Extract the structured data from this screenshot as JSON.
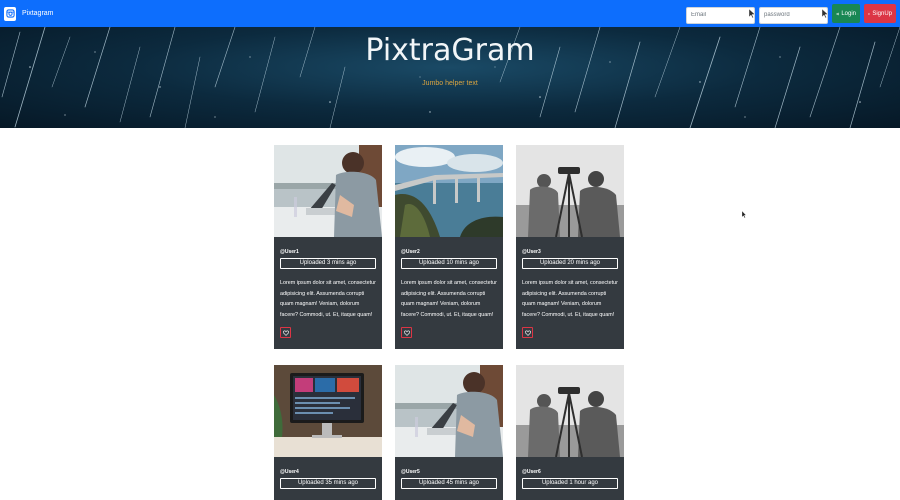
{
  "navbar": {
    "brand": "Pixtagram",
    "email_placeholder": "Email",
    "password_placeholder": "password",
    "login_label": "Login",
    "signup_label": "SignUp"
  },
  "jumbotron": {
    "title": "PixtraGram",
    "subtitle": "Jumbo helper text"
  },
  "posts": [
    {
      "user": "@User1",
      "uploaded": "Uploaded 3 mins ago",
      "text": "Lorem ipsum dolor sit amet, consectetur adipisicing elit. Assumenda corrupti quam magnam! Veniam, dolorum facere? Commodi, ut. Et, itaque quam!"
    },
    {
      "user": "@User2",
      "uploaded": "Uploaded 10 mins ago",
      "text": "Lorem ipsum dolor sit amet, consectetur adipisicing elit. Assumenda corrupti quam magnam! Veniam, dolorum facere? Commodi, ut. Et, itaque quam!"
    },
    {
      "user": "@User3",
      "uploaded": "Uploaded 20 mins ago",
      "text": "Lorem ipsum dolor sit amet, consectetur adipisicing elit. Assumenda corrupti quam magnam! Veniam, dolorum facere? Commodi, ut. Et, itaque quam!"
    },
    {
      "user": "@User4",
      "uploaded": "Uploaded 35 mins ago",
      "text": ""
    },
    {
      "user": "@User5",
      "uploaded": "Uploaded 45 mins ago",
      "text": ""
    },
    {
      "user": "@User6",
      "uploaded": "Uploaded 1 hour ago",
      "text": ""
    }
  ],
  "colors": {
    "navbar": "#0d6efd",
    "login": "#198754",
    "signup": "#dc3545",
    "card": "#343a40",
    "subtitle": "#d9a441"
  }
}
